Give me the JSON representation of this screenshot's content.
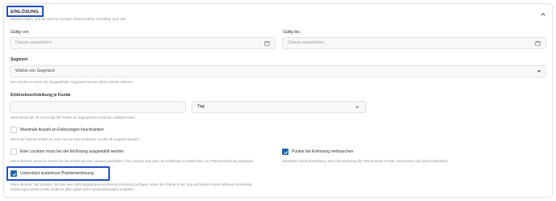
{
  "section": {
    "title": "EINLÖSUNG",
    "subtitle": "Steuere wann und für welche Kunden diese Prämie einlösbar sein soll."
  },
  "valid_from": {
    "label": "Gültig von",
    "placeholder": "Datum auswählen"
  },
  "valid_to": {
    "label": "Gültig bis",
    "placeholder": "Datum auswählen"
  },
  "segment": {
    "label": "Segment",
    "selected": "Wähle ein Segment",
    "help": "Nur Kunden in einem der ausgewählten Segmente können diese Prämie einlösen."
  },
  "limit_per_customer": {
    "label": "Einlösebeschränkung je Kunde",
    "amount_value": "",
    "unit_selected": "Tag",
    "help": "Beschränke wie oft ein Kunde die Prämie im angegebenen Zeitraum einlösen kann."
  },
  "max_redemptions": {
    "label": "Maximale Anzahl an Einlösungen beschränken",
    "checked": false,
    "help": "Wenn die Prämie limitiert ist, kann sie nur eine bestimmte Anzahl oft eingelöst werden."
  },
  "location_required": {
    "label": "Eine Location muss bei der Einlösung ausgewählt werden",
    "checked": false,
    "help": "Wenn aktiviert, muss ein Kunde bei der Einlösung eine Location auswählen. Die Location wird dann im Dashboard und Berichten zur Prämieneinlösung angezeigt."
  },
  "consume_points": {
    "label": "Punkte bei Einlösung verbrauchen",
    "checked": true,
    "help": "Deaktiviere diese Einstellung, wenn die Einlösung der Prämie keine Punkte verbrauchen soll (nicht empfohlen)."
  },
  "free_redemption": {
    "label": "Unterstützt kostenlose Prämieneinlösung",
    "checked": true,
    "help_line1": "Wenn aktiviert: Nur Kunden, die über eine nicht abgelaufene kostenlose Einlösung verfügen, sehen die Prämie in der App und können diese einlösen. Kostenlose",
    "help_line2": "Einlösungen werden unter anderem über Spiele oder Automatisierungen vergeben."
  },
  "colors": {
    "highlight": "#1f4fc9",
    "checkbox_checked": "#1f66b0",
    "input_bg": "#f7f8f9",
    "muted_text": "#8a929b"
  },
  "icons": [
    "chevron-up-icon",
    "calendar-icon",
    "caret-down-icon",
    "chevron-down-icon",
    "check-icon"
  ]
}
